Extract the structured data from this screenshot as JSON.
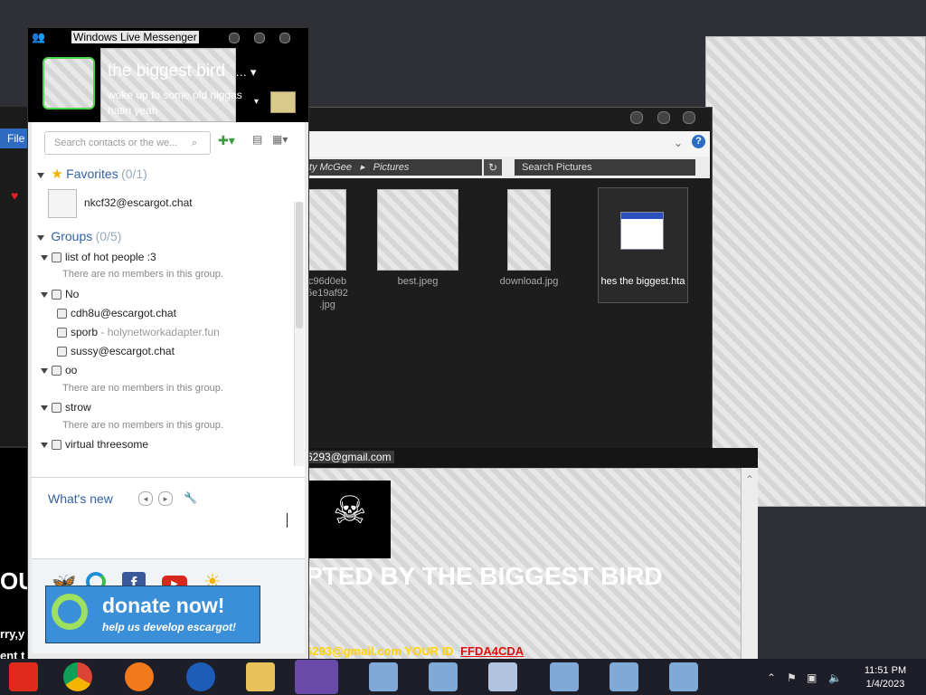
{
  "messenger": {
    "title": "Windows Live Messenger",
    "display_name": "the biggest bird",
    "personal_message": "woke up to some old niggas hatin yeah",
    "search_placeholder": "Search contacts or the we...",
    "favorites_label": "Favorites",
    "favorites_count": "(0/1)",
    "favorites": [
      "nkcf32@escargot.chat"
    ],
    "groups_label": "Groups",
    "groups_count": "(0/5)",
    "groups": [
      {
        "name": "list of hot people :3",
        "empty_text": "There are no members in this group."
      },
      {
        "name": "No",
        "members": [
          {
            "name": "cdh8u@escargot.chat",
            "status": ""
          },
          {
            "name": "sporb",
            "status": "holynetworkadapter.fun"
          },
          {
            "name": "sussy@escargot.chat",
            "status": ""
          }
        ]
      },
      {
        "name": "oo",
        "empty_text": "There are no members in this group."
      },
      {
        "name": "strow",
        "empty_text": "There are no members in this group."
      },
      {
        "name": "virtual threesome"
      }
    ],
    "whats_new": "What's new",
    "donate_title": "donate now!",
    "donate_sub": "help us develop escargot!"
  },
  "explorer": {
    "menu_file": "File",
    "breadcrumb_1": "ilty McGee",
    "breadcrumb_2": "Pictures",
    "search_placeholder": "Search Pictures",
    "files": [
      {
        "name": "c96d0eb 5e19af92 .jpg"
      },
      {
        "name": "best.jpeg"
      },
      {
        "name": "download.jpg"
      },
      {
        "name": "hes the biggest.hta"
      }
    ]
  },
  "browser": {
    "title_fragment": "6293@gmail.com",
    "banner": "PTED BY THE BIGGEST BIRD",
    "banner_left": "OU",
    "email_line": "6293@gmail.com  YOUR ID",
    "id_value": "FFDA4CDA",
    "left_text_1": "rry,y",
    "left_text_2": "ent t"
  },
  "taskbar": {
    "time": "11:51 PM",
    "date": "1/4/2023"
  }
}
